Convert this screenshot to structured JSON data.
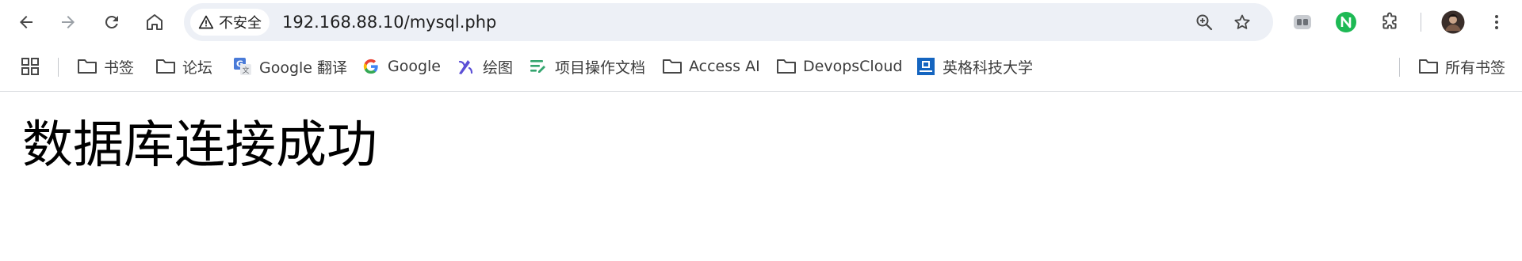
{
  "colors": {
    "toolbar_bg": "#ffffff",
    "omnibox_bg": "#edf0f6",
    "icon_gray": "#474747",
    "text_dark": "#1f1f1f",
    "bookmark_text": "#3c3c3c",
    "ext_green": "#1db954",
    "google_translate_blue": "#4a7bd8",
    "draw_purple": "#5b4fd6",
    "docs_green": "#34a56f",
    "university_blue": "#1565c0"
  },
  "toolbar": {
    "back_icon": "arrow-left-icon",
    "forward_icon": "arrow-right-icon",
    "reload_icon": "reload-icon",
    "home_icon": "home-icon",
    "security_label": "不安全",
    "security_icon": "warning-triangle-icon",
    "url": "192.168.88.10/mysql.php",
    "zoom_icon": "zoom-in-icon",
    "bookmark_star_icon": "star-icon",
    "extensions": [
      {
        "name": "tab-manager-extension",
        "icon": "extension-gray-icon"
      },
      {
        "name": "n-extension",
        "icon": "n-green-icon",
        "letter": "N"
      },
      {
        "name": "extensions-menu",
        "icon": "puzzle-icon"
      }
    ],
    "profile_icon": "avatar-icon",
    "menu_icon": "kebab-menu-icon"
  },
  "bookmarks": {
    "apps_icon": "apps-grid-icon",
    "items": [
      {
        "label": "书签",
        "icon": "folder-icon"
      },
      {
        "label": "论坛",
        "icon": "folder-icon"
      },
      {
        "label": "Google 翻译",
        "icon": "google-translate-icon"
      },
      {
        "label": "Google",
        "icon": "google-g-icon"
      },
      {
        "label": "绘图",
        "icon": "draw-icon"
      },
      {
        "label": "项目操作文档",
        "icon": "docs-icon"
      },
      {
        "label": "Access AI",
        "icon": "folder-icon"
      },
      {
        "label": "DevopsCloud",
        "icon": "folder-icon"
      },
      {
        "label": "英格科技大学",
        "icon": "university-icon"
      }
    ],
    "all_bookmarks": {
      "label": "所有书签",
      "icon": "folder-icon"
    }
  },
  "page": {
    "heading": "数据库连接成功"
  }
}
